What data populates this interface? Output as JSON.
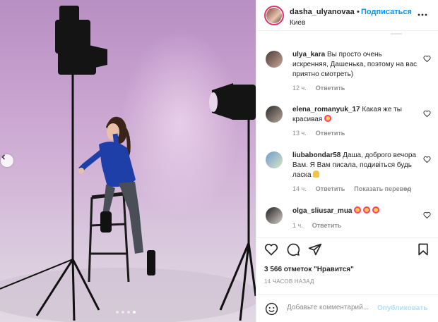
{
  "header": {
    "username": "dasha_ulyanovaa",
    "separator": "•",
    "follow_label": "Подписаться",
    "location": "Киев"
  },
  "comments": [
    {
      "username": "ulya_kara",
      "text": "Вы просто очень искренняя, Дашенька, поэтому на вас приятно смотреть)",
      "time": "12 ч.",
      "reply_label": "Ответить"
    },
    {
      "username": "elena_romanyuk_17",
      "text": "Какая же ты красивая",
      "emoji": "heart-eyes-emoji",
      "time": "13 ч.",
      "reply_label": "Ответить"
    },
    {
      "username": "liubabondar58",
      "text": "Даша, доброго вечора Вам. Я Вам писала, подивіться будь ласка",
      "emoji": "folded-hands-emoji",
      "time": "14 ч.",
      "reply_label": "Ответить",
      "translate_label": "Показать перевод",
      "more_label": "•••"
    },
    {
      "username": "olga_sliusar_mua",
      "text": "",
      "emoji": "heart-eyes-emoji x3",
      "time": "1 ч.",
      "reply_label": "Ответить"
    }
  ],
  "likes_text": "3 566 отметок \"Нравится\"",
  "post_time": "14 ЧАСОВ НАЗАД",
  "comment_box": {
    "placeholder": "Добавьте комментарий...",
    "post_label": "Опубликовать"
  },
  "carousel": {
    "slides": 4,
    "active_slide": 4
  },
  "colors": {
    "accent": "#0095f6",
    "post_disabled": "#b2dffc",
    "muted": "#8e8e8e",
    "backdrop": "#c8a2cf"
  }
}
